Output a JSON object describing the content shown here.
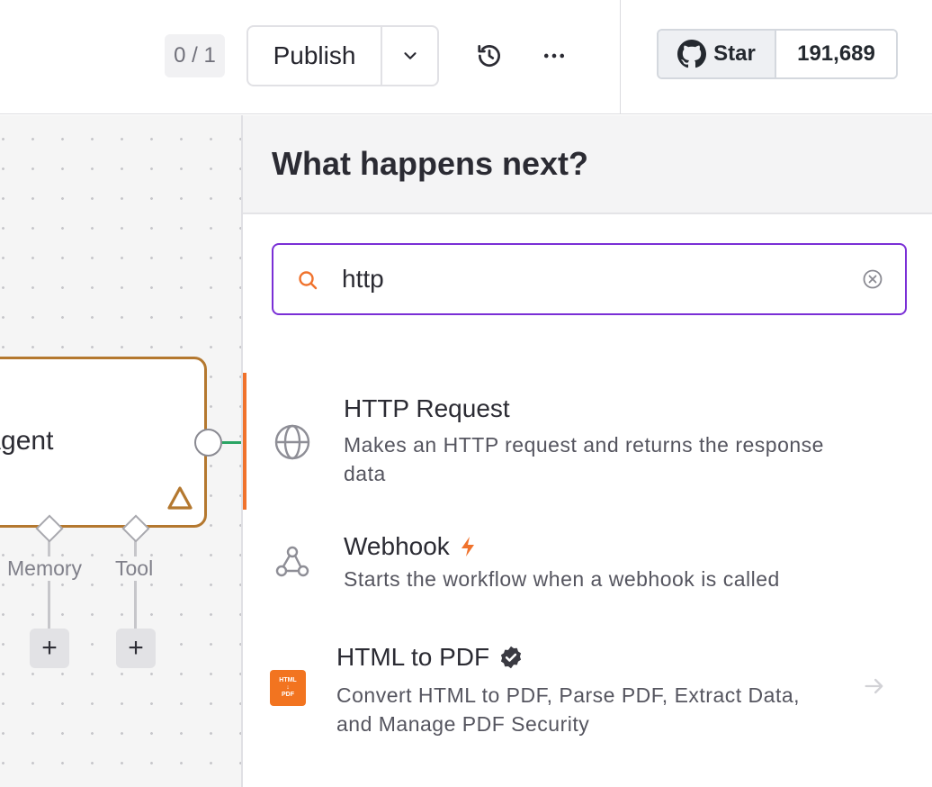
{
  "topbar": {
    "counter": "0 / 1",
    "publish_label": "Publish",
    "github": {
      "star_label": "Star",
      "star_count": "191,689"
    }
  },
  "canvas": {
    "node_label": "Agent",
    "sub_nodes": [
      {
        "label": "Memory",
        "add_label": "+"
      },
      {
        "label": "Tool",
        "add_label": "+"
      }
    ]
  },
  "panel": {
    "title": "What happens next?",
    "search": {
      "value": "http"
    },
    "items": [
      {
        "title": "HTTP Request",
        "description_line1": "Makes an HTTP request and returns the response",
        "description_line2": "data",
        "icon": "globe-icon"
      },
      {
        "title": "Webhook",
        "description_line1": "Starts the workflow when a webhook is called",
        "icon": "webhook-icon",
        "badge_icon": "lightning-icon"
      },
      {
        "title": "HTML to PDF",
        "description_line1": "Convert HTML to PDF, Parse PDF, Extract Data,",
        "description_line2": "and Manage PDF Security",
        "icon": "html-to-pdf-logo",
        "badge_icon": "verified-icon",
        "logo_text_top": "HTML",
        "logo_text_arrow": "↓",
        "logo_text_bottom": "PDF"
      }
    ]
  },
  "colors": {
    "accent_orange": "#f0722c",
    "search_border": "#7a2fd6",
    "node_border": "#b4782f",
    "connector_green": "#2aa564"
  }
}
